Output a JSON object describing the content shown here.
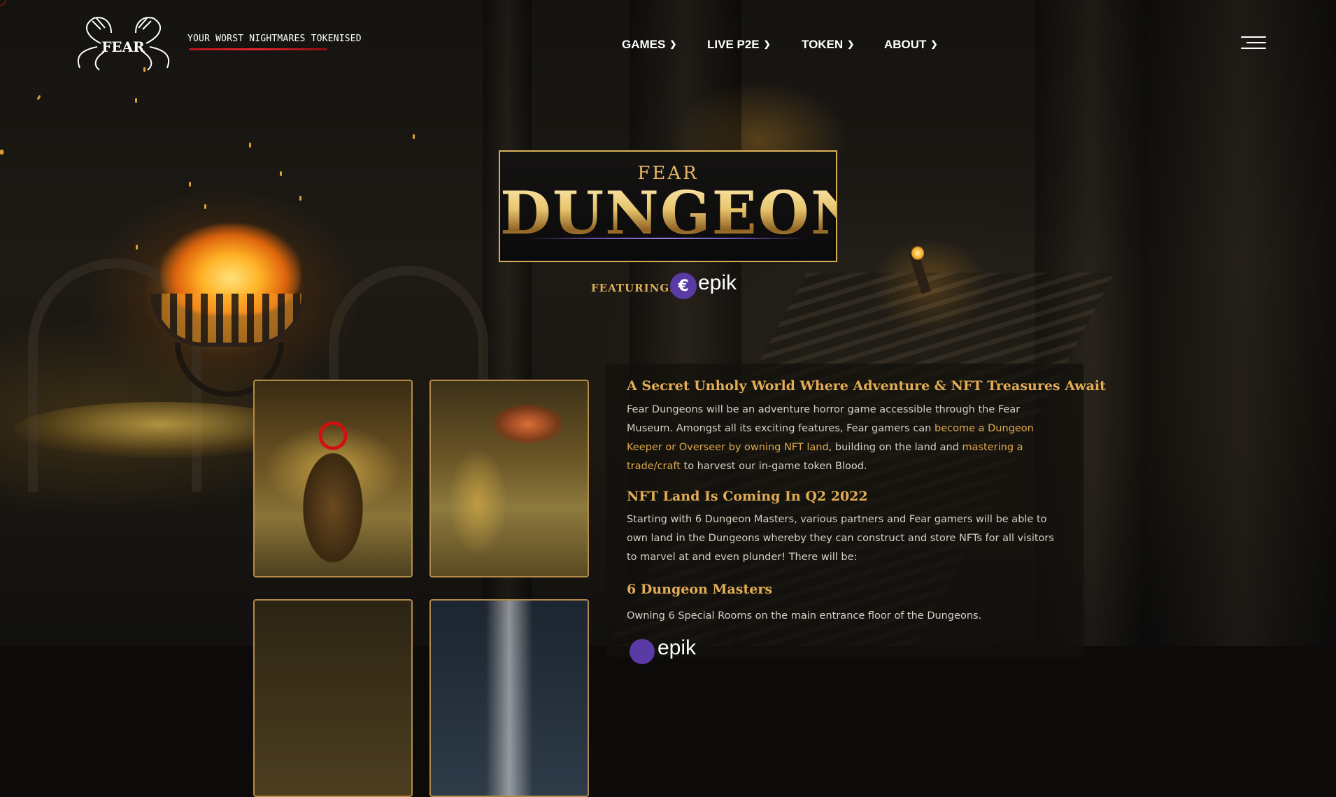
{
  "header": {
    "tagline": "YOUR WORST NIGHTMARES TOKENISED",
    "logo_text": "FEAR",
    "nav": [
      {
        "label": "GAMES"
      },
      {
        "label": "LIVE P2E"
      },
      {
        "label": "TOKEN"
      },
      {
        "label": "ABOUT"
      }
    ],
    "menu_icon": "hamburger-menu-icon"
  },
  "hero": {
    "badge_top": "FEAR",
    "badge_word": "DUNGEONS",
    "featuring_label": "FEATURING:",
    "partner_name": "epik",
    "partner_icon": "epik-logo-icon"
  },
  "content": {
    "heading_1": "A Secret Unholy World Where Adventure & NFT Treasures Await",
    "para_1": {
      "text_a": "Fear Dungeons will be an adventure horror game accessible through the Fear Museum. Amongst all its exciting features, Fear gamers can ",
      "link_1": "become a Dungeon Keeper or Overseer by owning NFT land",
      "text_b": ", building on the land and ",
      "link_2": "mastering a trade/craft",
      "text_c": " to harvest our in-game token Blood."
    },
    "heading_2": "NFT Land Is Coming In Q2 2022",
    "para_2": "Starting with 6 Dungeon Masters, various partners and Fear gamers will be able to own land in the Dungeons whereby they can construct and store NFTs for all visitors to marvel at and even plunder! There will be:",
    "heading_3": "6 Dungeon Masters",
    "para_3": "Owning 6 Special Rooms on the main entrance floor of the Dungeons.",
    "partner_mini": "epik"
  },
  "colors": {
    "accent_gold": "#e3ad56",
    "link_gold": "#e0a84c",
    "tagline_red": "#e3262c",
    "epik_purple": "#5a3ba6",
    "thumb_border": "#b38a45"
  }
}
